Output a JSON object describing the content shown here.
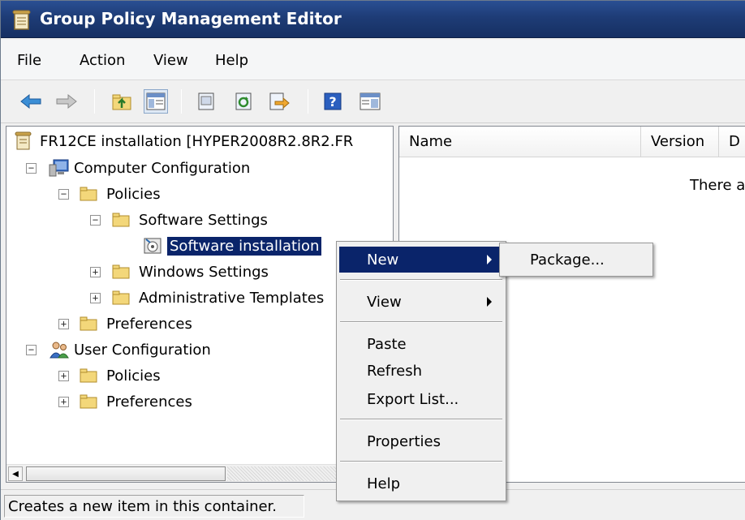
{
  "window": {
    "title": "Group Policy Management Editor"
  },
  "menu": {
    "items": [
      "File",
      "Action",
      "View",
      "Help"
    ]
  },
  "toolbar": {
    "buttons": [
      "back-arrow-icon",
      "forward-arrow-icon",
      "up-folder-icon",
      "show-hide-tree-icon",
      "properties-icon",
      "refresh-icon",
      "export-list-icon",
      "help-icon",
      "console-tree-icon"
    ]
  },
  "tree": {
    "root": "FR12CE installation [HYPER2008R2.8R2.FR",
    "computer_config": "Computer Configuration",
    "policies": "Policies",
    "software_settings": "Software Settings",
    "software_installation": "Software installation",
    "windows_settings": "Windows Settings",
    "admin_templates": "Administrative Templates",
    "preferences": "Preferences",
    "user_config": "User Configuration",
    "user_policies": "Policies",
    "user_preferences": "Preferences"
  },
  "list": {
    "columns": [
      "Name",
      "Version",
      "D"
    ],
    "empty_message": "There a"
  },
  "context_menu": {
    "items": [
      "New",
      "View",
      "Paste",
      "Refresh",
      "Export List...",
      "Properties",
      "Help"
    ],
    "highlighted": "New"
  },
  "submenu": {
    "items": [
      "Package..."
    ]
  },
  "status": {
    "text": "Creates a new item in this container."
  },
  "colors": {
    "titlebar": "#1e3c76",
    "selection": "#0a246a",
    "folder": "#f3d77a"
  }
}
